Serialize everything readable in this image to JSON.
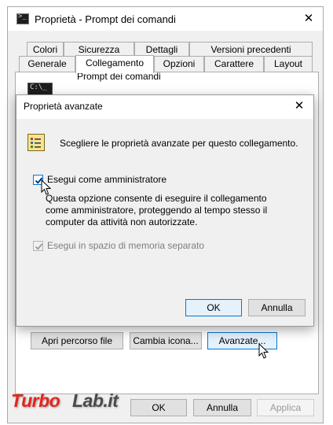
{
  "outer_window": {
    "title": "Proprietà - Prompt dei comandi",
    "close_glyph": "✕",
    "tabs_top_row": [
      "Colori",
      "Sicurezza",
      "Dettagli",
      "Versioni precedenti"
    ],
    "tabs_bottom_row": [
      "Generale",
      "Collegamento",
      "Opzioni",
      "Carattere",
      "Layout"
    ],
    "active_tab": "Collegamento",
    "app_name": "Prompt dei comandi",
    "app_icon_text": "C:\\_",
    "buttons": {
      "open_location": "Apri percorso file",
      "change_icon": "Cambia icona...",
      "advanced": "Avanzate..."
    },
    "footer_buttons": {
      "ok": "OK",
      "cancel": "Annulla",
      "apply": "Applica"
    }
  },
  "advanced_dialog": {
    "title": "Proprietà avanzate",
    "close_glyph": "✕",
    "header_text": "Scegliere le proprietà avanzate per questo collegamento.",
    "run_as_admin": {
      "label": "Esegui come amministratore",
      "checked": true
    },
    "description": "Questa opzione consente di eseguire il collegamento come amministratore, proteggendo al tempo stesso il computer da attività non autorizzate.",
    "separate_memory": {
      "label": "Esegui in spazio di memoria separato",
      "checked": true,
      "disabled": true
    },
    "buttons": {
      "ok": "OK",
      "cancel": "Annulla"
    }
  },
  "watermark": {
    "part1": "Turbo",
    "part2": "Lab.it"
  },
  "colors": {
    "accent": "#0078d7",
    "watermark_red": "#e3261d"
  }
}
